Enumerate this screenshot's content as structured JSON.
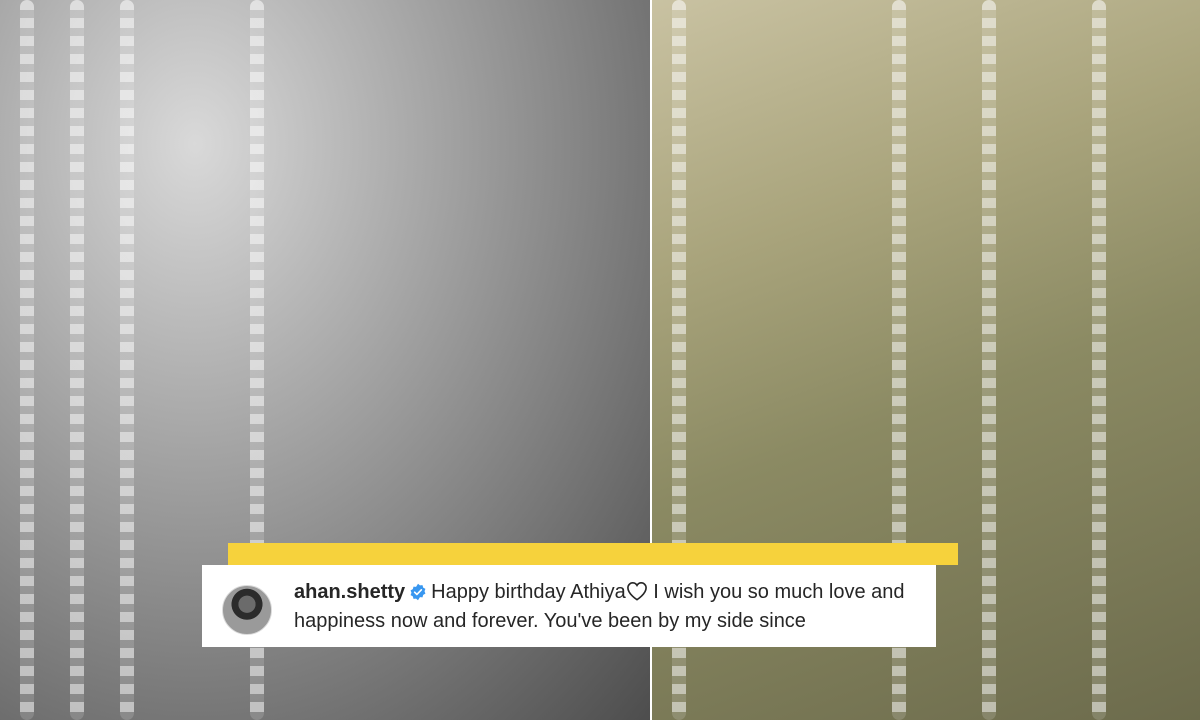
{
  "caption": {
    "username": "ahan.shetty",
    "text_before_heart": "Happy birthday Athiya",
    "text_after_heart": " I wish you so much love and happiness now and forever. You've been by my side since"
  },
  "icons": {
    "verified": "verified-badge-icon",
    "heart": "heart-icon"
  },
  "colors": {
    "highlight": "#f6d23c",
    "verified": "#3897f0"
  }
}
